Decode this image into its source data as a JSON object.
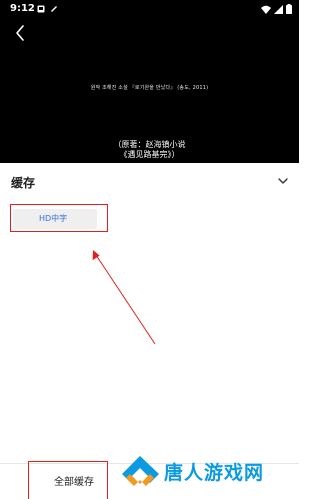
{
  "status_bar": {
    "time": "9:12"
  },
  "video": {
    "subtitle_text": "원작    조해진 소설 『로기완을 만났다』  (송도, 2011)",
    "credit_line1": "（原著：赵海镇小说",
    "credit_line2": "《遇见路基完》）"
  },
  "cache_panel": {
    "title": "缓存",
    "quality_option": "HD中字"
  },
  "bottom": {
    "download_all_label": "全部缓存"
  },
  "watermark": {
    "text": "唐人游戏网"
  },
  "colors": {
    "annotation_red": "#e2201c",
    "link_blue": "#3a6fd8",
    "watermark_blue": "#0c9be0",
    "watermark_orange": "#f39a1e"
  }
}
